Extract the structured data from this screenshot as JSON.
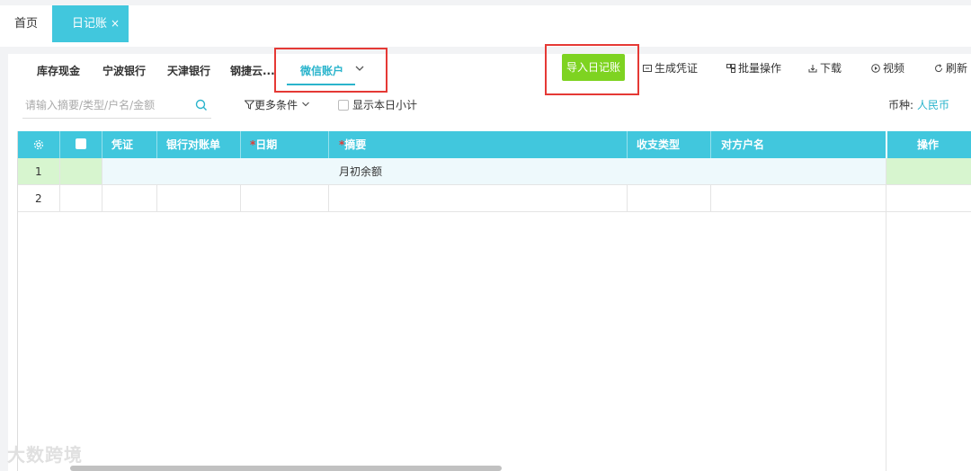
{
  "top_tabs": {
    "home": "首页",
    "journal": "日记账",
    "journal_close": "×"
  },
  "accounts": [
    "库存现金",
    "宁波银行",
    "天津银行",
    "钢捷云...",
    "微信账户"
  ],
  "toolbar": {
    "import": "导入日记账",
    "generate": "生成凭证",
    "batch": "批量操作",
    "download": "下载",
    "video": "视频",
    "refresh": "刷新"
  },
  "filters": {
    "search_placeholder": "请输入摘要/类型/户名/金额",
    "more": "更多条件",
    "daily_subtotal": "显示本日小计",
    "currency_label": "币种:",
    "currency_value": "人民币"
  },
  "table": {
    "headers": {
      "voucher": "凭证",
      "bank_stmt": "银行对账单",
      "date": "日期",
      "summary": "摘要",
      "type": "收支类型",
      "party": "对方户名",
      "actions": "操作",
      "required_mark": "*"
    },
    "rows": [
      {
        "no": "1",
        "summary": "月初余额"
      },
      {
        "no": "2",
        "summary": ""
      }
    ]
  },
  "watermark": "大数跨境",
  "colors": {
    "accent": "#41c7dd",
    "import_btn": "#7ed321",
    "highlight_box": "#e53935"
  }
}
